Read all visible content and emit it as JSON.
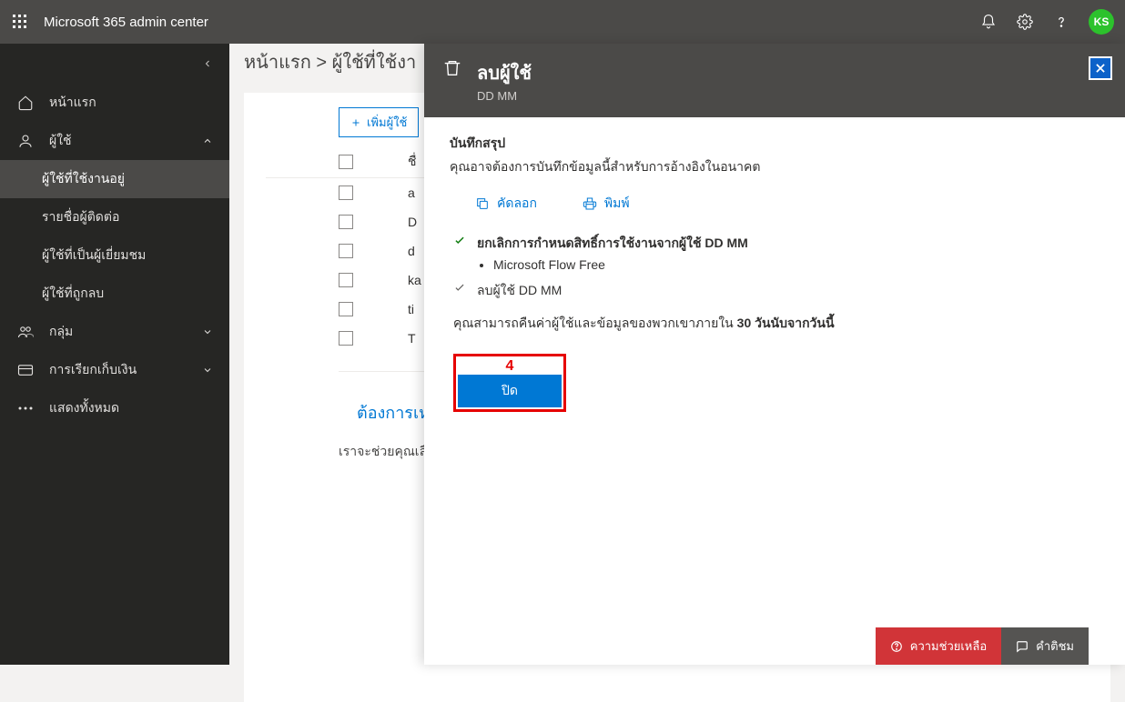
{
  "header": {
    "title": "Microsoft 365 admin center",
    "avatar": "KS"
  },
  "sidebar": {
    "home": "หน้าแรก",
    "users": "ผู้ใช้",
    "sub": {
      "active": "ผู้ใช้ที่ใช้งานอยู่",
      "contacts": "รายชื่อผู้ติดต่อ",
      "guests": "ผู้ใช้ที่เป็นผู้เยี่ยมชม",
      "deleted": "ผู้ใช้ที่ถูกลบ"
    },
    "groups": "กลุ่ม",
    "billing": "การเรียกเก็บเงิน",
    "showall": "แสดงทั้งหมด"
  },
  "breadcrumb": {
    "home": "หน้าแรก",
    "sep": " > ",
    "current": "ผู้ใช้ที่ใช้งา"
  },
  "toolbar": {
    "addUser": "เพิ่มผู้ใช้"
  },
  "table": {
    "colname": "ชื่",
    "rows": [
      "a",
      "D",
      "d",
      "ka",
      "ti",
      "T"
    ]
  },
  "help": {
    "title": "ต้องการเห",
    "text": "เราจะช่วยคุณเลือ"
  },
  "flyout": {
    "title": "ลบผู้ใช้",
    "subtitle": "DD MM",
    "summary_title": "บันทึกสรุป",
    "summary_desc": "คุณอาจต้องการบันทึกข้อมูลนี้สำหรับการอ้างอิงในอนาคต",
    "copy": "คัดลอก",
    "print": "พิมพ์",
    "status1_b": "ยกเลิกการกำหนดสิทธิ์การใช้งานจากผู้ใช้ DD MM",
    "status1_li": "Microsoft Flow Free",
    "status2": "ลบผู้ใช้ DD MM",
    "recover_a": "คุณสามารถคืนค่าผู้ใช้และข้อมูลของพวกเขาภายใน ",
    "recover_b": "30 วันนับจากวันนี้",
    "callout_num": "4",
    "close_btn": "ปิด"
  },
  "footer": {
    "help": "ความช่วยเหลือ",
    "feedback": "คำติชม"
  }
}
